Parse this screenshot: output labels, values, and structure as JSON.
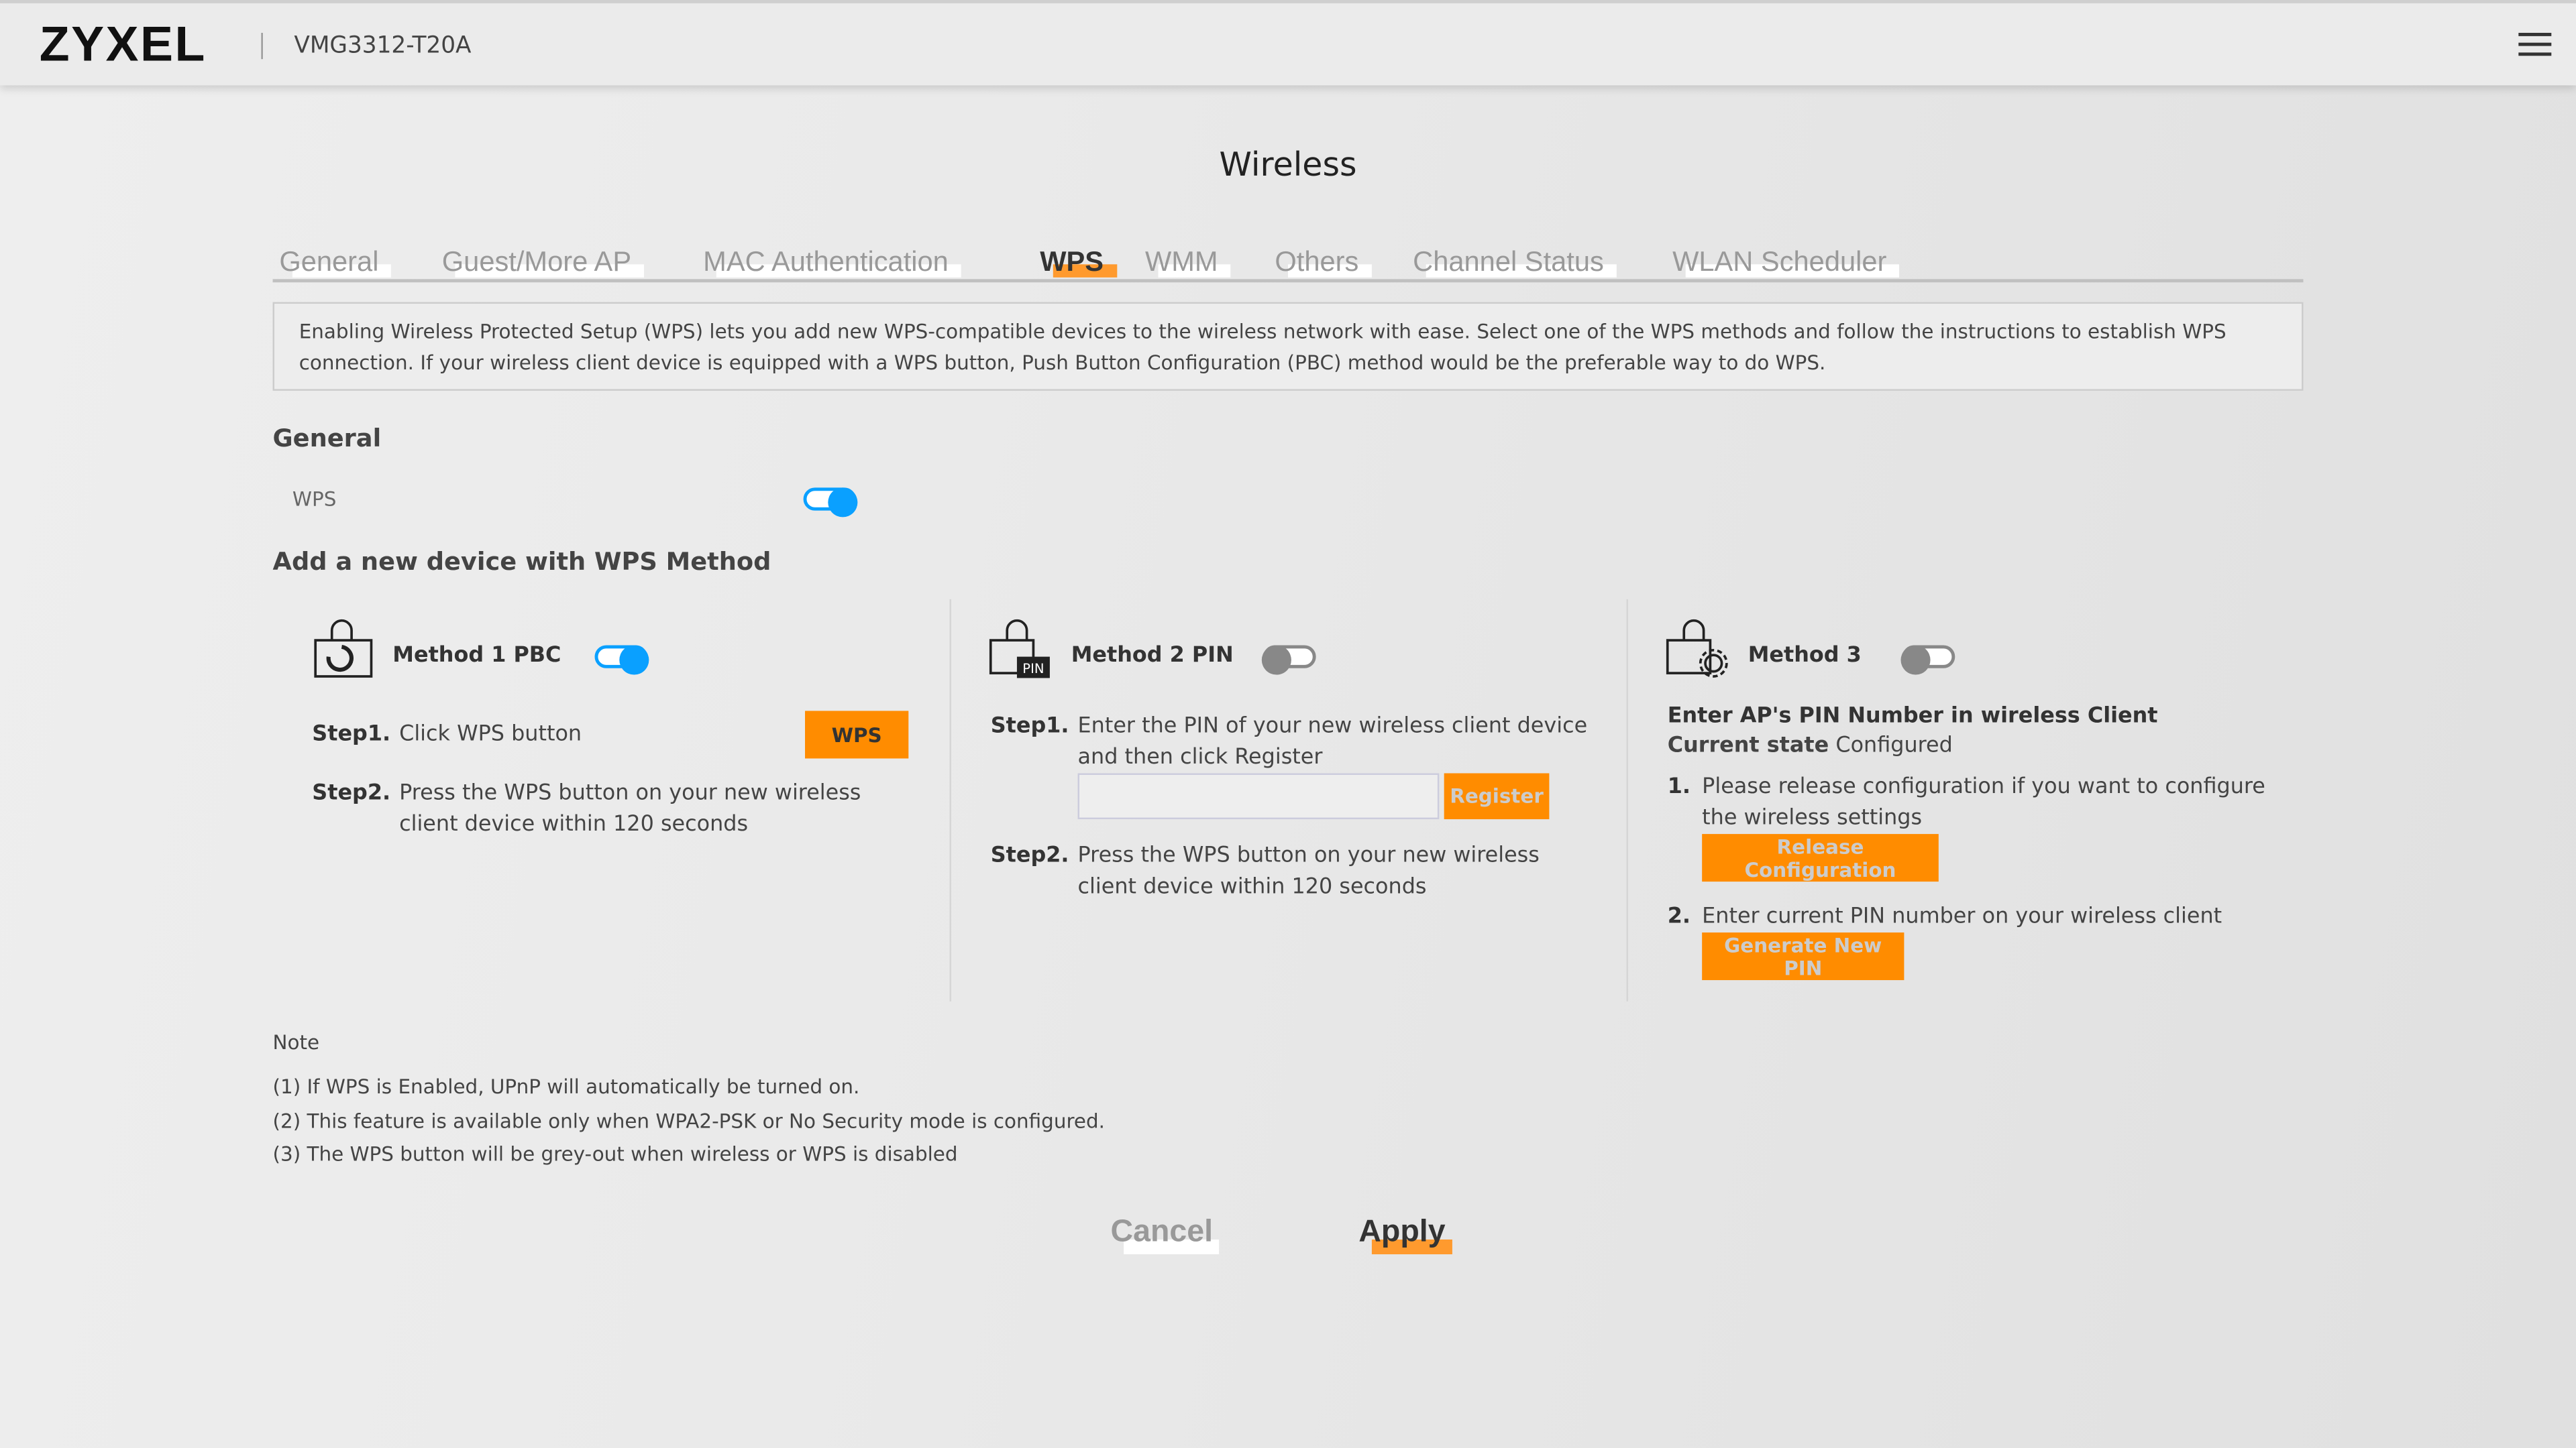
{
  "header": {
    "logo": "ZYXEL",
    "model": "VMG3312-T20A",
    "menu_icon": "hamburger-icon"
  },
  "page": {
    "title": "Wireless"
  },
  "tabs": [
    {
      "label": "General"
    },
    {
      "label": "Guest/More AP"
    },
    {
      "label": "MAC Authentication"
    },
    {
      "label": "WPS",
      "active": true
    },
    {
      "label": "WMM"
    },
    {
      "label": "Others"
    },
    {
      "label": "Channel Status"
    },
    {
      "label": "WLAN Scheduler"
    }
  ],
  "description": "Enabling Wireless Protected Setup (WPS) lets you add new WPS-compatible devices to the wireless network with ease. Select one of the WPS methods and follow the instructions to establish WPS connection. If your wireless client device is equipped with a WPS button, Push Button Configuration (PBC) method would be the preferable way to do WPS.",
  "general": {
    "heading": "General",
    "wps_label": "WPS",
    "wps_enabled": true
  },
  "add_heading": "Add a new device with WPS Method",
  "method1": {
    "title": "Method 1 PBC",
    "enabled": true,
    "step1_label": "Step1.",
    "step1_text": "Click WPS button",
    "wps_button": "WPS",
    "step2_label": "Step2.",
    "step2_text": "Press the WPS button on your new wireless client device within 120 seconds"
  },
  "method2": {
    "title": "Method 2 PIN",
    "enabled": false,
    "step1_label": "Step1.",
    "step1_text": "Enter the PIN of your new wireless client device and then click Register",
    "pin_value": "",
    "register_button": "Register",
    "step2_label": "Step2.",
    "step2_text": "Press the WPS button on your new wireless client device within 120 seconds"
  },
  "method3": {
    "title": "Method 3",
    "enabled": false,
    "heading": "Enter AP's PIN Number in wireless Client",
    "state_label": "Current state",
    "state_value": "Configured",
    "item1_num": "1.",
    "item1_text": "Please release configuration if you want to configure the wireless settings",
    "release_button": "Release Configuration",
    "item2_num": "2.",
    "item2_text": "Enter current PIN number on your wireless client",
    "generate_button": "Generate New PIN"
  },
  "notes": {
    "heading": "Note",
    "items": [
      "(1) If WPS is Enabled, UPnP will automatically be turned on.",
      "(2) This feature is available only when WPA2-PSK or No Security mode is configured.",
      "(3) The WPS button will be grey-out when wireless or WPS is disabled"
    ]
  },
  "actions": {
    "cancel": "Cancel",
    "apply": "Apply"
  },
  "colors": {
    "accent": "#ff8c00",
    "toggle_on": "#0aa0ff"
  }
}
